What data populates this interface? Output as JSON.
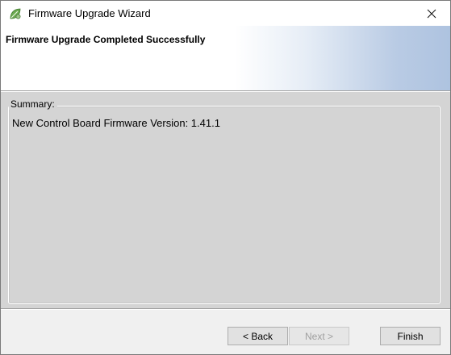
{
  "window": {
    "title": "Firmware Upgrade Wizard",
    "icon": "leaf-gear-app-icon",
    "close_glyph": "✕"
  },
  "header": {
    "title": "Firmware Upgrade Completed Successfully"
  },
  "summary": {
    "legend": "Summary:",
    "line": "New Control Board Firmware Version: 1.41.1"
  },
  "footer": {
    "back_label": "< Back",
    "next_label": "Next >",
    "next_enabled": false,
    "finish_label": "Finish"
  },
  "colors": {
    "accent": "#aec3e0",
    "body_background": "#d4d4d4",
    "icon_green": "#6aa84f"
  }
}
